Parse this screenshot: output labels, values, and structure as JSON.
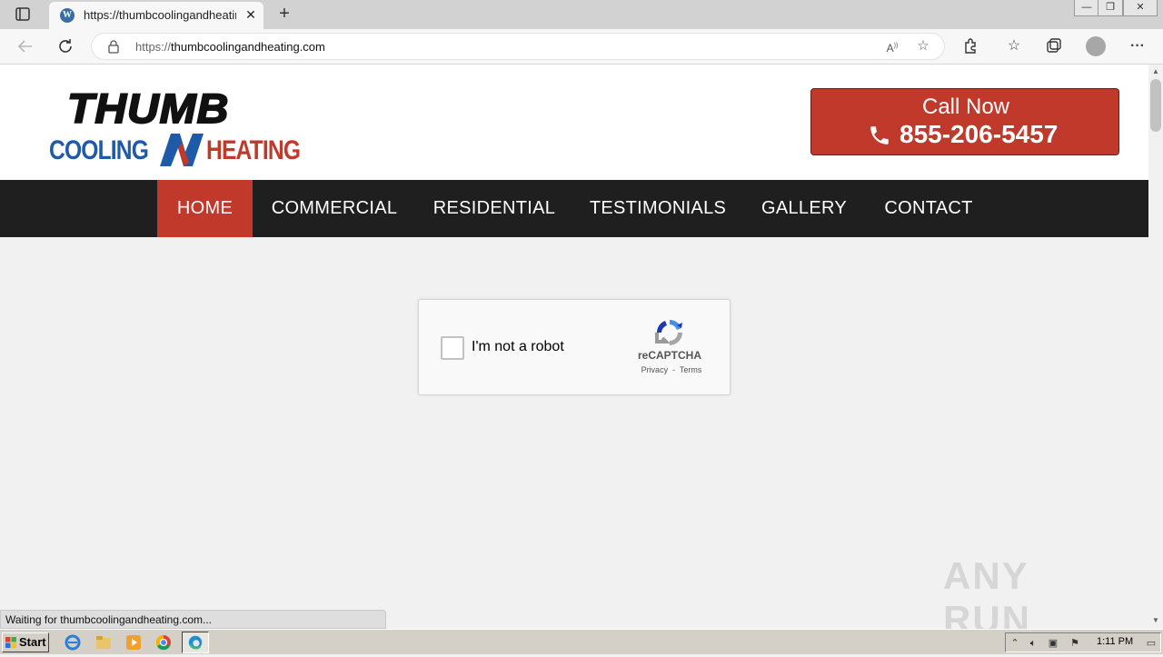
{
  "browser": {
    "tab_title": "https://thumbcoolingandheating.com",
    "url_scheme": "https://",
    "url_host": "thumbcoolingandheating.com",
    "status_text": "Waiting for thumbcoolingandheating.com..."
  },
  "site": {
    "logo_top": "THUMB",
    "logo_left": "COOLING",
    "logo_right": "HEATING",
    "call_label": "Call Now",
    "call_phone": "855-206-5457",
    "brand_red": "#c0392b",
    "nav_bg": "#1f1f1f",
    "nav": [
      {
        "label": "HOME",
        "active": true
      },
      {
        "label": "COMMERCIAL",
        "active": false
      },
      {
        "label": "RESIDENTIAL",
        "active": false
      },
      {
        "label": "TESTIMONIALS",
        "active": false
      },
      {
        "label": "GALLERY",
        "active": false
      },
      {
        "label": "CONTACT",
        "active": false
      }
    ]
  },
  "captcha": {
    "label": "I'm not a robot",
    "brand": "reCAPTCHA",
    "privacy": "Privacy",
    "terms": "Terms"
  },
  "watermark": "ANY RUN",
  "taskbar": {
    "start_label": "Start",
    "clock": "1:11 PM"
  }
}
